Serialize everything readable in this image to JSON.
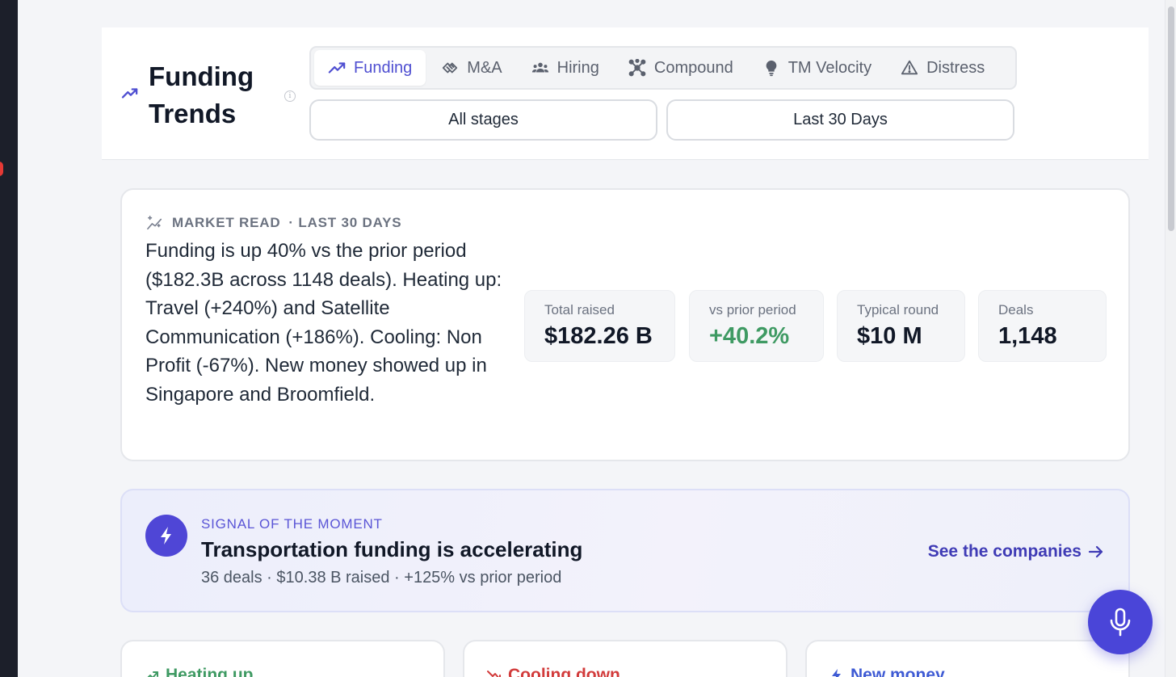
{
  "header": {
    "title": "Funding Trends",
    "info_glyph": "i",
    "tabs": [
      {
        "label": "Funding",
        "icon": "trending-up-icon",
        "active": true
      },
      {
        "label": "M&A",
        "icon": "handshake-icon",
        "active": false
      },
      {
        "label": "Hiring",
        "icon": "users-icon",
        "active": false
      },
      {
        "label": "Compound",
        "icon": "network-icon",
        "active": false
      },
      {
        "label": "TM Velocity",
        "icon": "lightbulb-icon",
        "active": false
      },
      {
        "label": "Distress",
        "icon": "alert-triangle-icon",
        "active": false
      }
    ],
    "filters": {
      "stages": "All stages",
      "range": "Last 30 Days"
    }
  },
  "market_read": {
    "label": "MARKET READ",
    "period": "· LAST 30 DAYS",
    "summary": "Funding is up 40% vs the prior period ($182.3B across 1148 deals). Heating up: Travel (+240%) and Satellite Communication (+186%). Cooling: Non Profit (-67%). New money showed up in Singapore and Broomfield.",
    "stats": [
      {
        "label": "Total raised",
        "value": "$182.26 B"
      },
      {
        "label": "vs prior period",
        "value": "+40.2%"
      },
      {
        "label": "Typical round",
        "value": "$10 M"
      },
      {
        "label": "Deals",
        "value": "1,148"
      }
    ]
  },
  "signal": {
    "kicker": "SIGNAL OF THE MOMENT",
    "headline": "Transportation funding is accelerating",
    "meta": "36 deals · $10.38 B raised · +125% vs prior period",
    "link": "See the companies"
  },
  "panels": [
    {
      "title": "Heating up",
      "color": "#3f9a63"
    },
    {
      "title": "Cooling down",
      "color": "#d23b3b"
    },
    {
      "title": "New money",
      "color": "#3f5bd4"
    }
  ],
  "colors": {
    "accent": "#4f46d6",
    "positive": "#3f9a63",
    "negative": "#d23b3b"
  }
}
